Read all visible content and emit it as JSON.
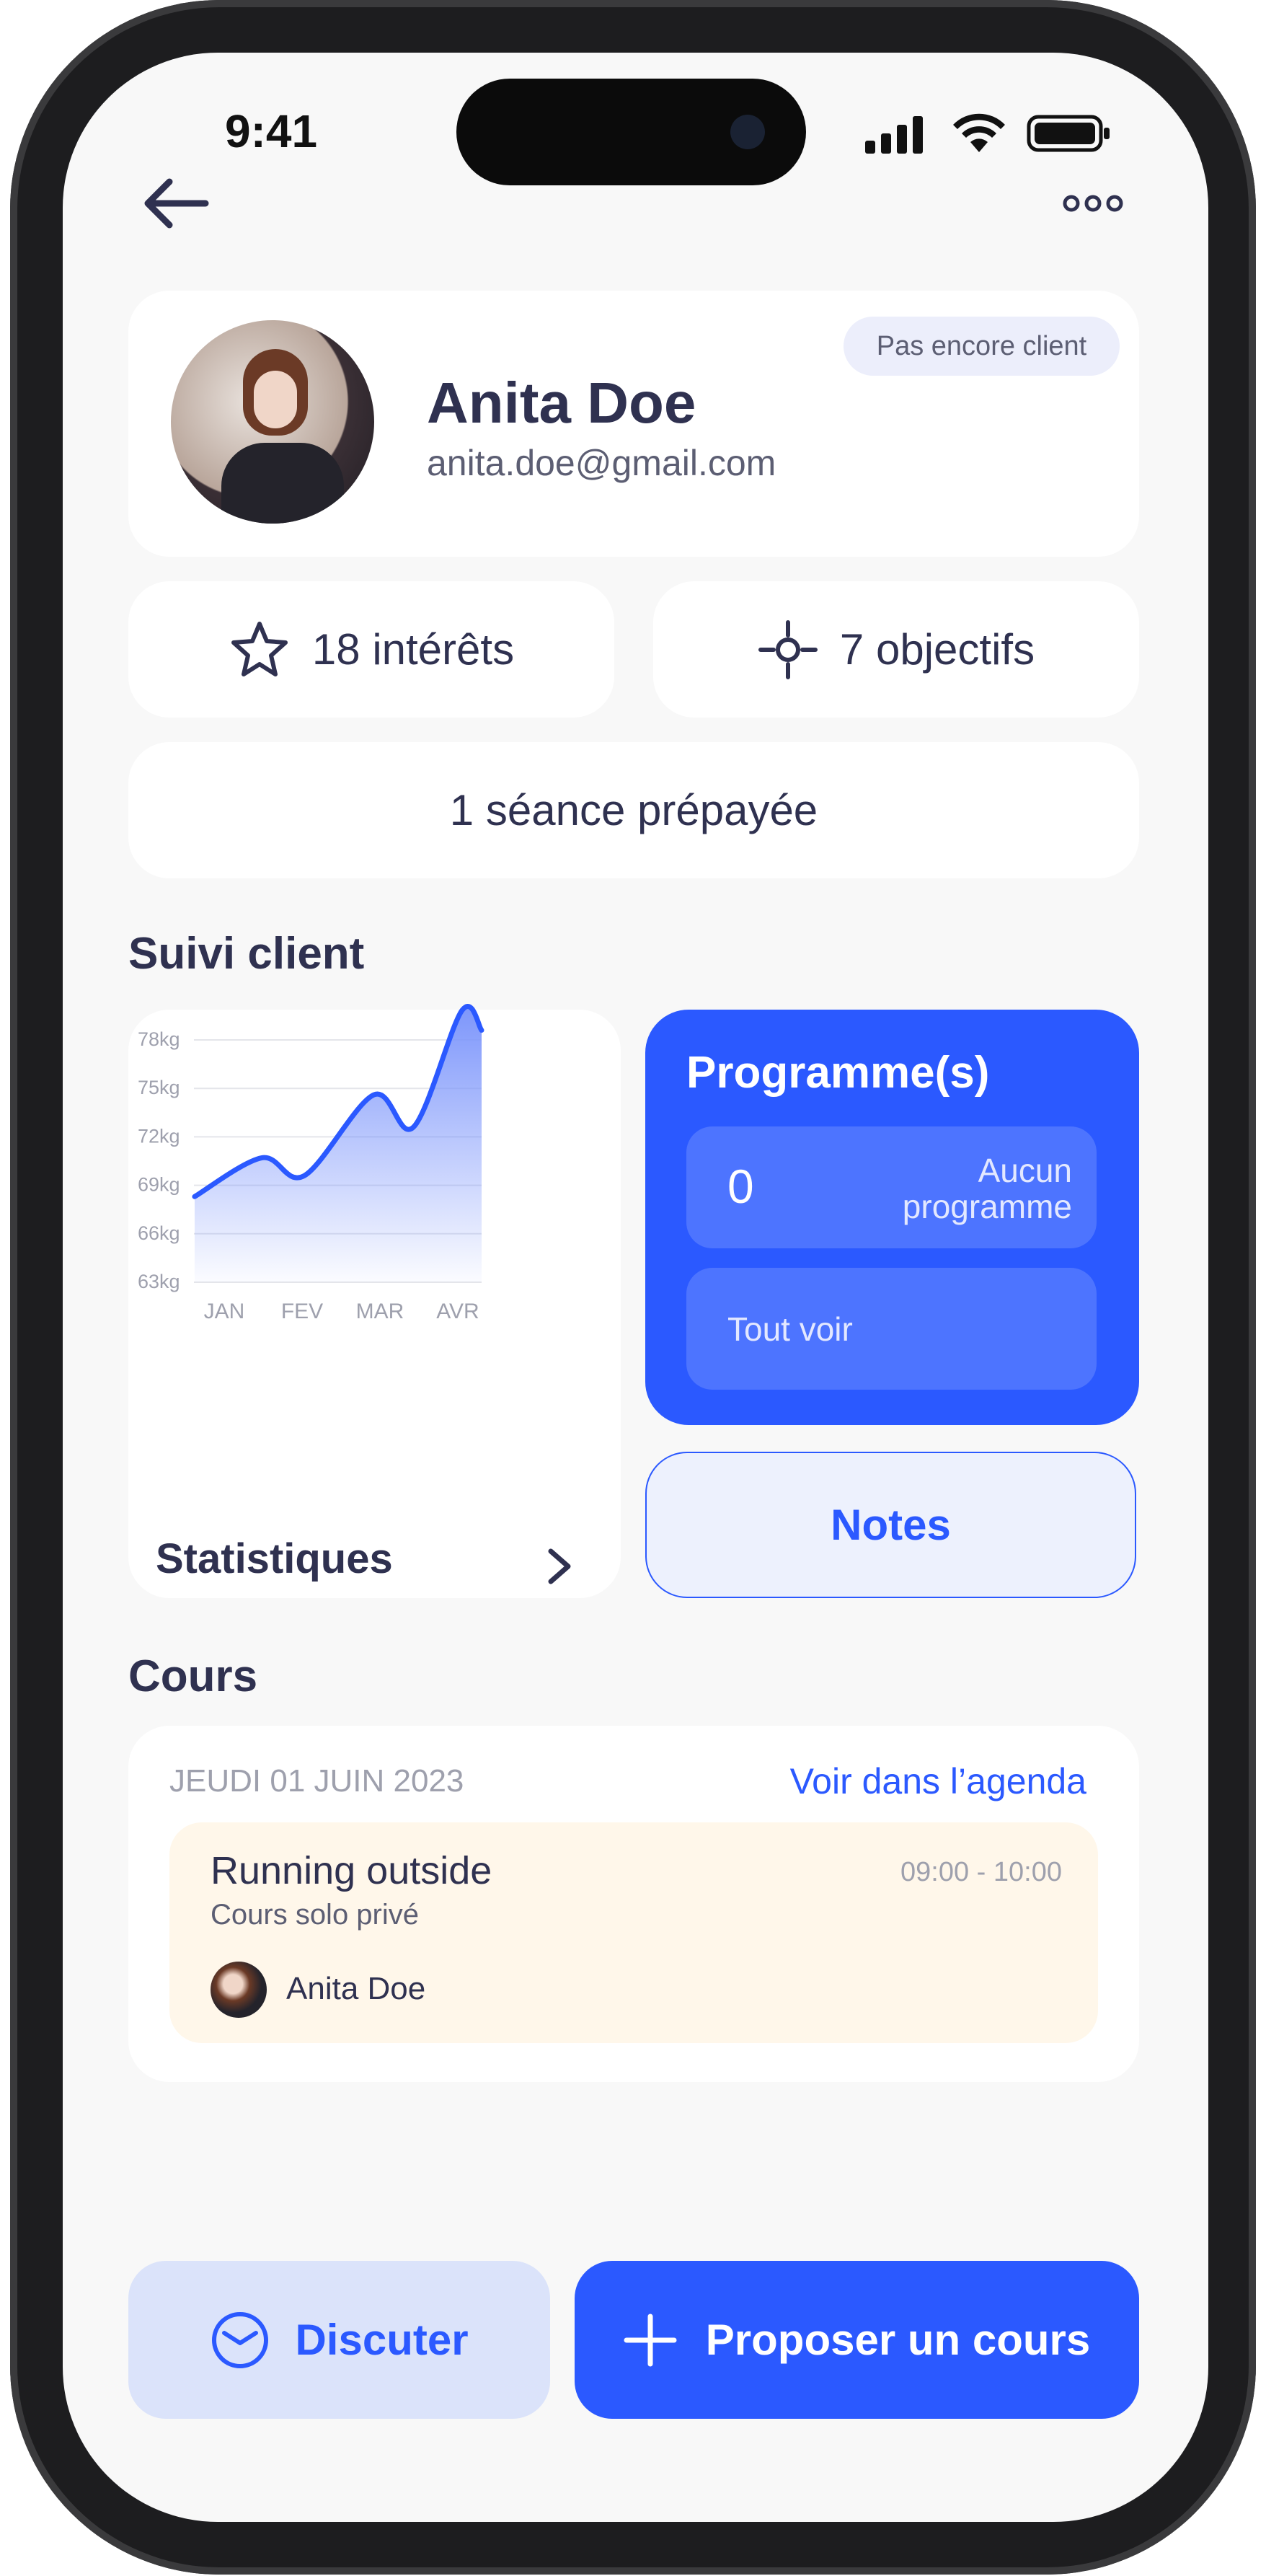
{
  "status_bar": {
    "time": "9:41",
    "icons": [
      "signal-icon",
      "wifi-icon",
      "battery-icon"
    ]
  },
  "nav": {
    "back_icon": "arrow-left-icon",
    "more_icon": "more-horizontal-icon"
  },
  "profile": {
    "name": "Anita Doe",
    "email": "anita.doe@gmail.com",
    "badge": "Pas encore client"
  },
  "stats": {
    "interests": {
      "icon": "star-icon",
      "label": "18 intérêts"
    },
    "objectives": {
      "icon": "target-icon",
      "label": "7 objectifs"
    },
    "sessions": {
      "label": "1 séance prépayée"
    }
  },
  "suivi": {
    "title": "Suivi client",
    "stats_label": "Statistiques",
    "chevron_icon": "chevron-right-icon"
  },
  "programmes": {
    "title": "Programme(s)",
    "count": "0",
    "count_label_1": "Aucun",
    "count_label_2": "programme",
    "see_all": "Tout voir"
  },
  "notes": {
    "label": "Notes"
  },
  "cours": {
    "title": "Cours",
    "date": "JEUDI 01 JUIN 2023",
    "agenda_link": "Voir dans l’agenda",
    "item": {
      "title": "Running outside",
      "subtitle": "Cours solo privé",
      "time": "09:00 - 10:00",
      "attendee": "Anita Doe"
    }
  },
  "actions": {
    "chat": "Discuter",
    "chat_icon": "mail-icon",
    "propose": "Proposer un cours",
    "propose_icon": "plus-icon"
  },
  "colors": {
    "accent": "#2b59ff",
    "text": "#2f3150",
    "badge_bg": "#eceefb",
    "course_bg": "#fff7ea",
    "chat_bg": "#dbe3fa"
  },
  "chart_data": {
    "type": "area",
    "categories": [
      "JAN",
      "FEV",
      "MAR",
      "AVR"
    ],
    "y_ticks": [
      "63kg",
      "66kg",
      "69kg",
      "72kg",
      "75kg",
      "78kg"
    ],
    "ylim": [
      63,
      78
    ],
    "grid": true,
    "series": [
      {
        "x": [
          0.62,
          1.48,
          2.03,
          2.92,
          3.43,
          4.05,
          4.31
        ],
        "values": [
          68.3,
          70.7,
          69.6,
          74.6,
          72.6,
          79.8,
          78.6
        ]
      }
    ]
  }
}
